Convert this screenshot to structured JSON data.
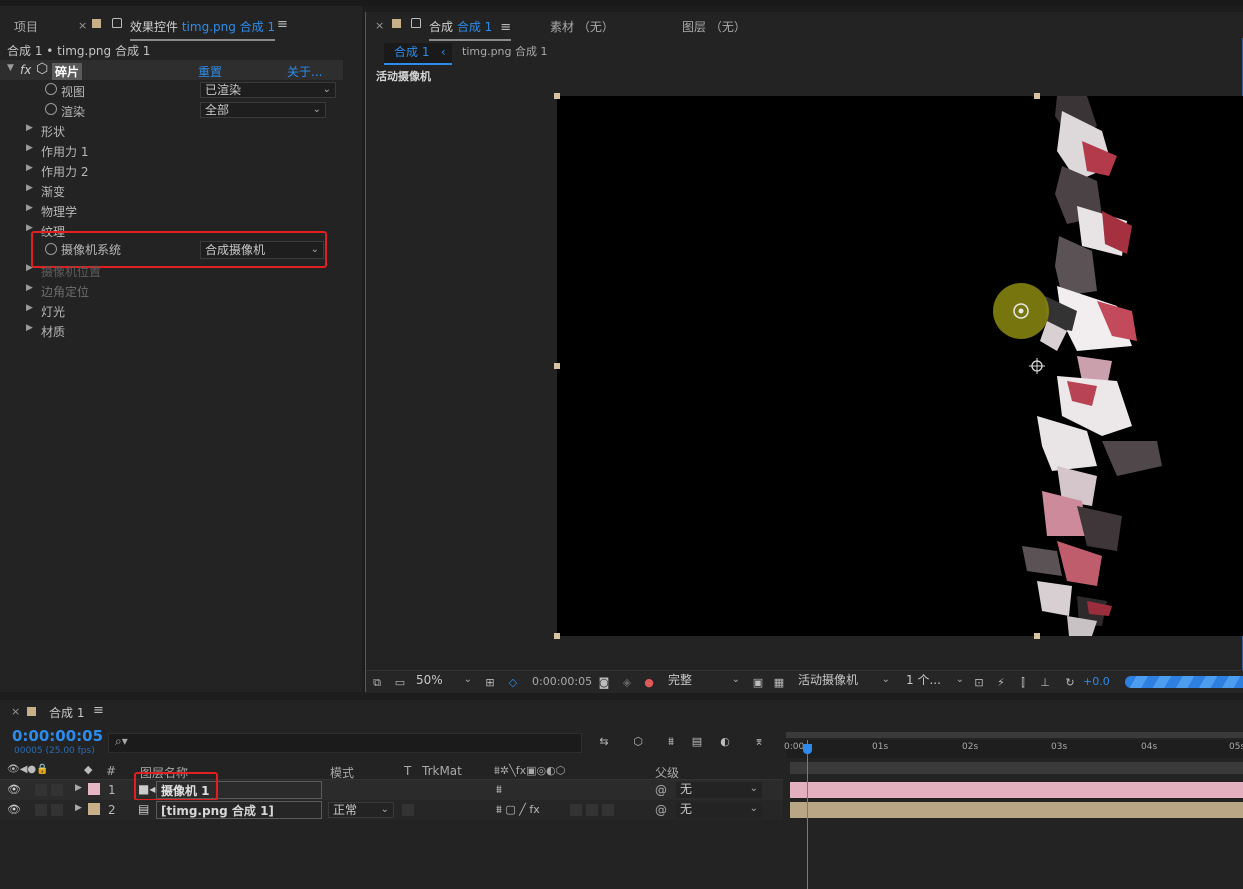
{
  "effect_panel": {
    "tab_project": "项目",
    "tab_effects_prefix": "效果控件",
    "tab_effects_layer": "timg.png 合成 1",
    "breadcrumb": "合成 1 • timg.png 合成 1",
    "effect_name": "碎片",
    "reset_label": "重置",
    "about_label": "关于...",
    "props": [
      {
        "label": "视图",
        "value": "已渲染"
      },
      {
        "label": "渲染",
        "value": "全部"
      }
    ],
    "groups": [
      "形状",
      "作用力 1",
      "作用力 2",
      "渐变",
      "物理学",
      "纹理"
    ],
    "camera_system": {
      "label": "摄像机系统",
      "value": "合成摄像机"
    },
    "groups_after": [
      "摄像机位置",
      "边角定位",
      "灯光",
      "材质"
    ]
  },
  "comp_panel": {
    "tab_comp_prefix": "合成",
    "tab_comp_name": "合成 1",
    "tab_footage": "素材 （无）",
    "tab_layer": "图层 （无）",
    "sub_tab": "合成 1",
    "sub_tab_next": "timg.png 合成 1",
    "view_label": "活动摄像机"
  },
  "viewer_toolbar": {
    "zoom": "50%",
    "timecode": "0:00:00:05",
    "quality": "完整",
    "camera": "活动摄像机",
    "views": "1 个...",
    "exposure": "+0.0"
  },
  "timeline": {
    "tab": "合成 1",
    "timecode": "0:00:00:05",
    "frames_fps": "00005 (25.00 fps)",
    "search_placeholder": "",
    "col_layer_name": "图层名称",
    "col_mode": "模式",
    "col_t": "T",
    "col_trkmat": "TrkMat",
    "col_parent": "父级",
    "ruler": [
      "0:00s",
      "01s",
      "02s",
      "03s",
      "04s",
      "05s"
    ],
    "layers": [
      {
        "index": "1",
        "name": "摄像机 1",
        "mode": "",
        "parent": "无",
        "color": "#e6b8c4"
      },
      {
        "index": "2",
        "name": "[timg.png 合成 1]",
        "mode": "正常",
        "parent": "无",
        "color": "#c8b08a"
      }
    ]
  },
  "colors": {
    "accent": "#2d8ceb",
    "highlight": "#e02020",
    "camera_bar": "#e3b0bf",
    "precomp_bar": "#b9a684"
  }
}
